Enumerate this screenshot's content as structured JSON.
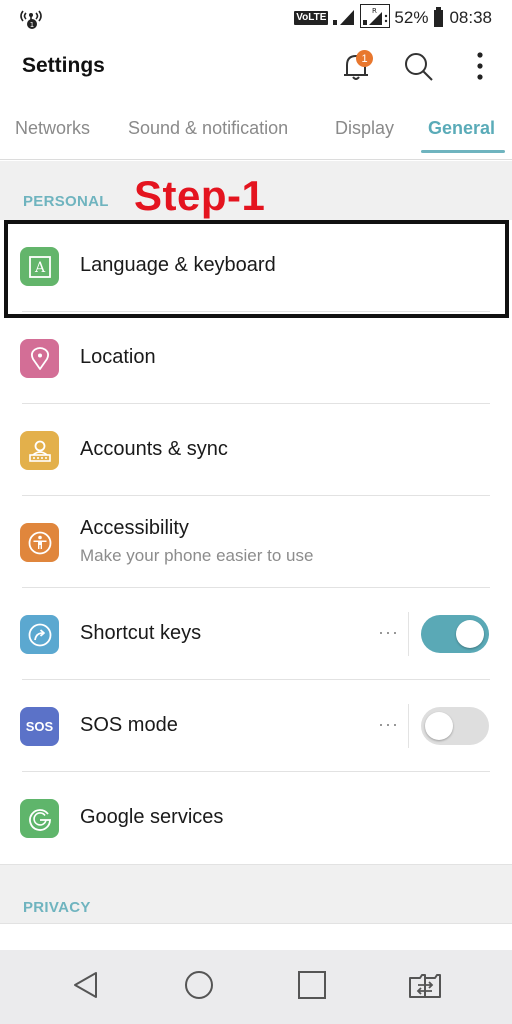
{
  "status_bar": {
    "left_icon": "wifi-calling-icon",
    "volte": "VoLTE",
    "sim1_signal": "signal-icon",
    "sim2_signal": "signal-roaming-icon",
    "battery_percent": "52%",
    "battery_icon": "battery-icon",
    "time": "08:38"
  },
  "app_bar": {
    "title": "Settings",
    "notification_badge": "1",
    "icons": [
      "notification-bell-icon",
      "search-icon",
      "more-vert-icon"
    ]
  },
  "tabs": [
    {
      "label": "Networks",
      "active": false
    },
    {
      "label": "Sound & notification",
      "active": false
    },
    {
      "label": "Display",
      "active": false
    },
    {
      "label": "General",
      "active": true
    }
  ],
  "annotation": {
    "step_label": "Step-1",
    "color": "#e4141f"
  },
  "sections": {
    "personal": {
      "label": "PERSONAL",
      "items": [
        {
          "label": "Language & keyboard",
          "icon": "language-keyboard-icon",
          "color": "#63b56b"
        },
        {
          "label": "Location",
          "icon": "location-pin-icon",
          "color": "#d36e96"
        },
        {
          "label": "Accounts & sync",
          "icon": "account-icon",
          "color": "#e3b04b"
        },
        {
          "label": "Accessibility",
          "subtitle": "Make your phone easier to use",
          "icon": "accessibility-icon",
          "color": "#e0863c"
        },
        {
          "label": "Shortcut keys",
          "icon": "shortcut-icon",
          "color": "#5ba8d0",
          "more": "···",
          "toggle": true
        },
        {
          "label": "SOS mode",
          "icon": "sos-icon",
          "icon_text": "SOS",
          "color": "#5b72c8",
          "more": "···",
          "toggle": false
        },
        {
          "label": "Google services",
          "icon": "google-icon",
          "color": "#5fb56b"
        }
      ]
    },
    "privacy": {
      "label": "PRIVACY"
    }
  },
  "colors": {
    "accent": "#5aabb8",
    "toggle_on": "#5aa9b6"
  },
  "nav_bar": {
    "buttons": [
      "back-icon",
      "home-icon",
      "recents-icon",
      "dual-window-icon"
    ]
  }
}
